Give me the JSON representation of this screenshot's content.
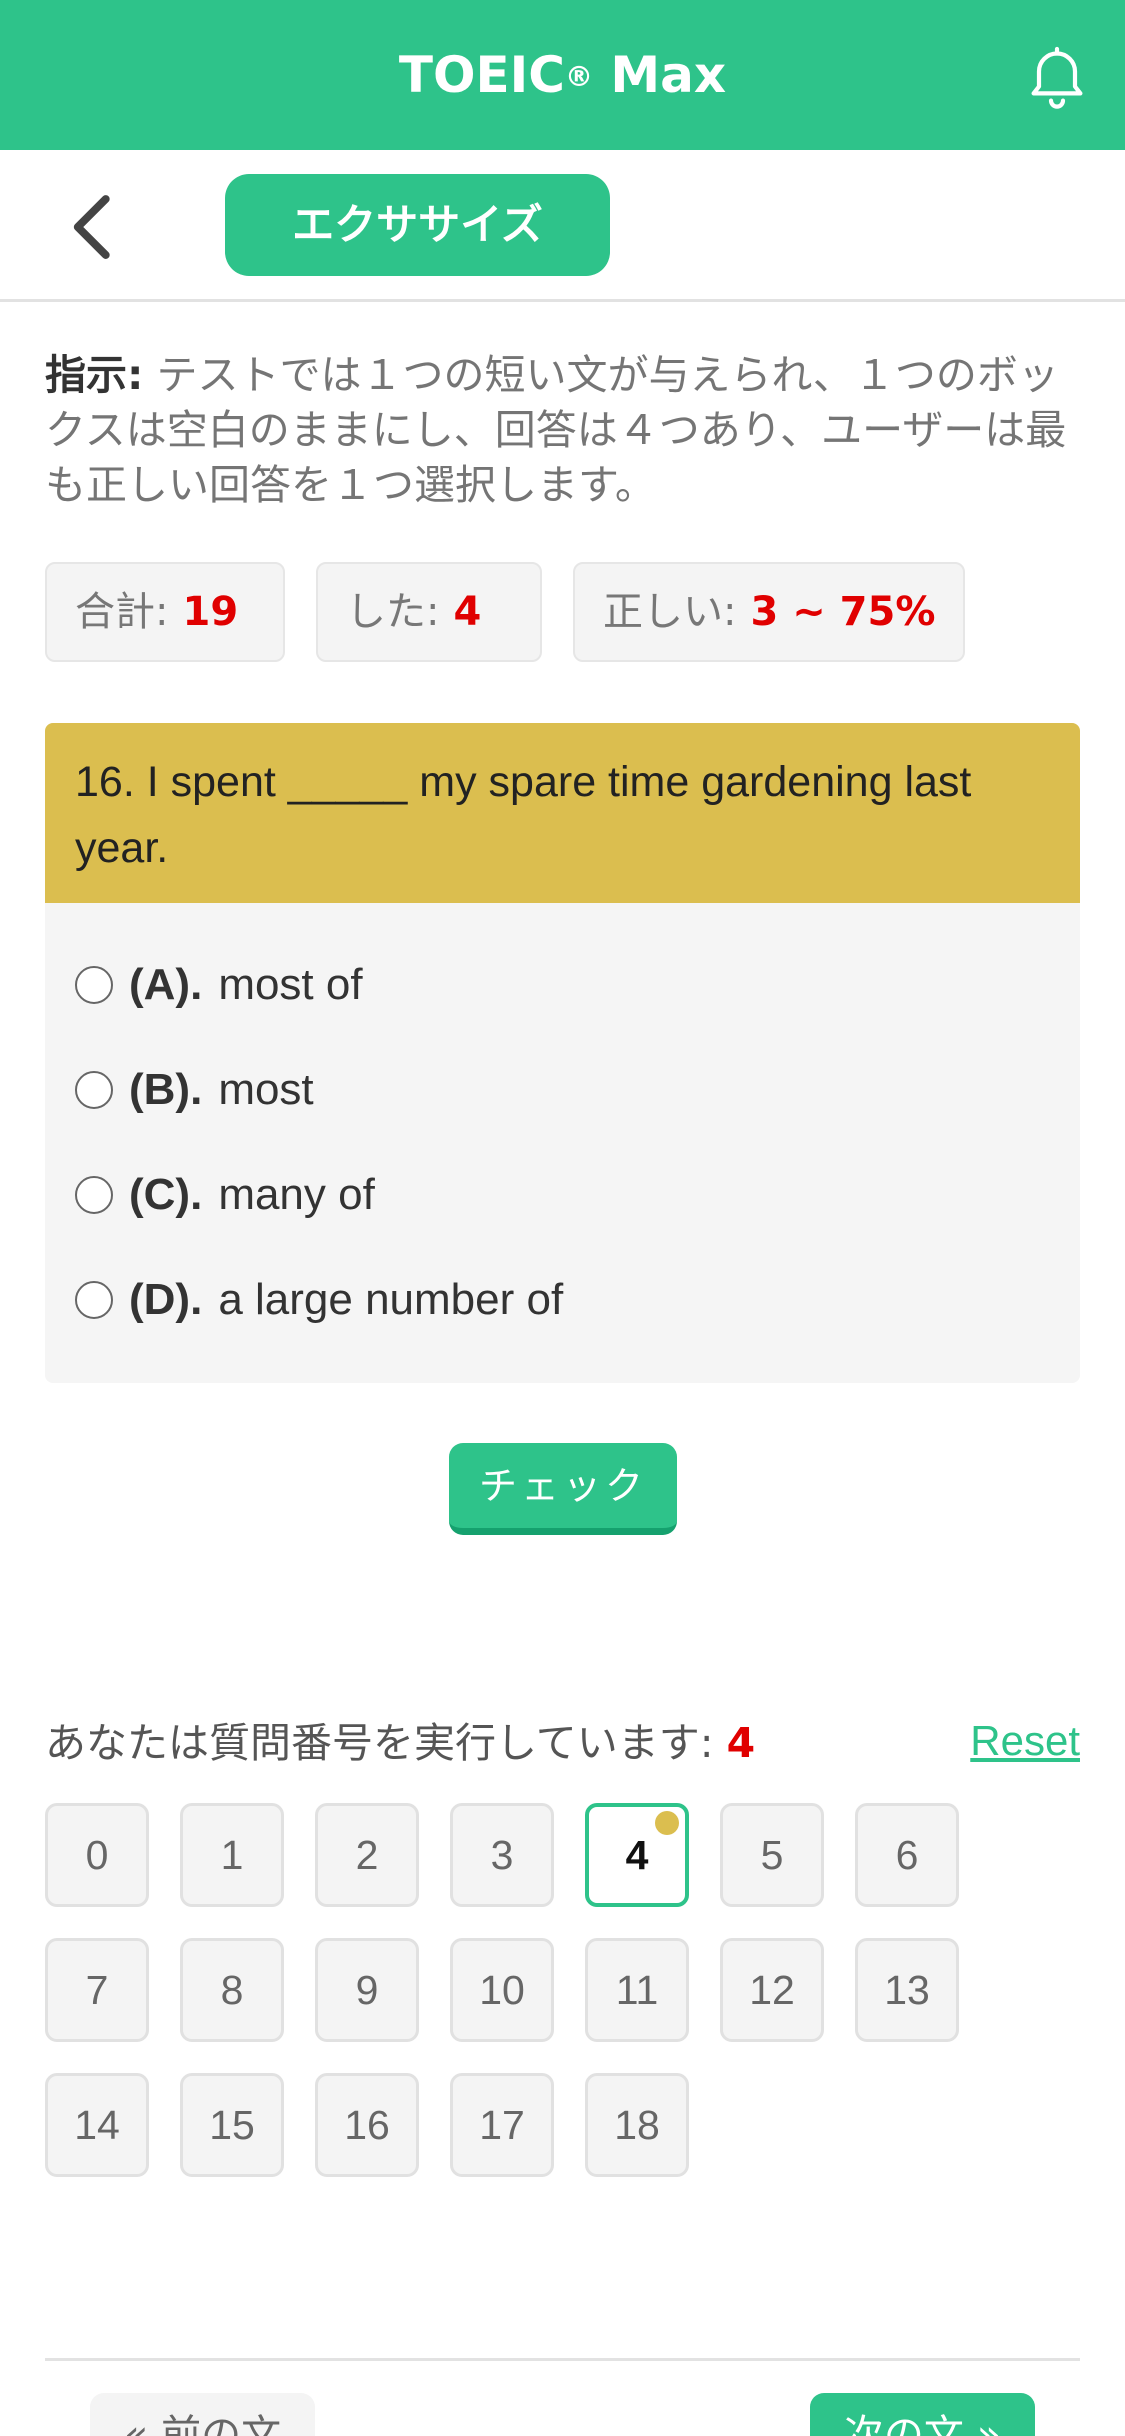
{
  "header": {
    "title": "TOEIC",
    "title_mark": "®",
    "title_suffix": " Max",
    "bell_icon": "bell-icon",
    "brand_color": "#2ec38a"
  },
  "subbar": {
    "back_icon": "chevron-left-icon",
    "tab_label": "エクササイズ"
  },
  "instructions": {
    "label": "指示:",
    "text": " テストでは１つの短い文が与えられ、１つのボックスは空白のままにし、回答は４つあり、ユーザーは最も正しい回答を１つ選択します。"
  },
  "stats": {
    "total_label": "合計:",
    "total_value": "19",
    "done_label": "した:",
    "done_value": "4",
    "correct_label": "正しい:",
    "correct_value": "3 ~ 75%"
  },
  "question": {
    "text": "16. I spent _____ my spare time gardening last year.",
    "options": [
      {
        "key": "(A).",
        "text": "most of"
      },
      {
        "key": "(B).",
        "text": "most"
      },
      {
        "key": "(C).",
        "text": "many of"
      },
      {
        "key": "(D).",
        "text": "a large number of"
      }
    ],
    "accent_color": "#dbbe4f"
  },
  "check_label": "チェック",
  "progress": {
    "label": "あなたは質問番号を実行しています:",
    "current": "4",
    "reset_label": "Reset"
  },
  "question_numbers": [
    "0",
    "1",
    "2",
    "3",
    "4",
    "5",
    "6",
    "7",
    "8",
    "9",
    "10",
    "11",
    "12",
    "13",
    "14",
    "15",
    "16",
    "17",
    "18"
  ],
  "nav": {
    "prev_label": "« 前の文",
    "next_label": "次の文 »"
  }
}
